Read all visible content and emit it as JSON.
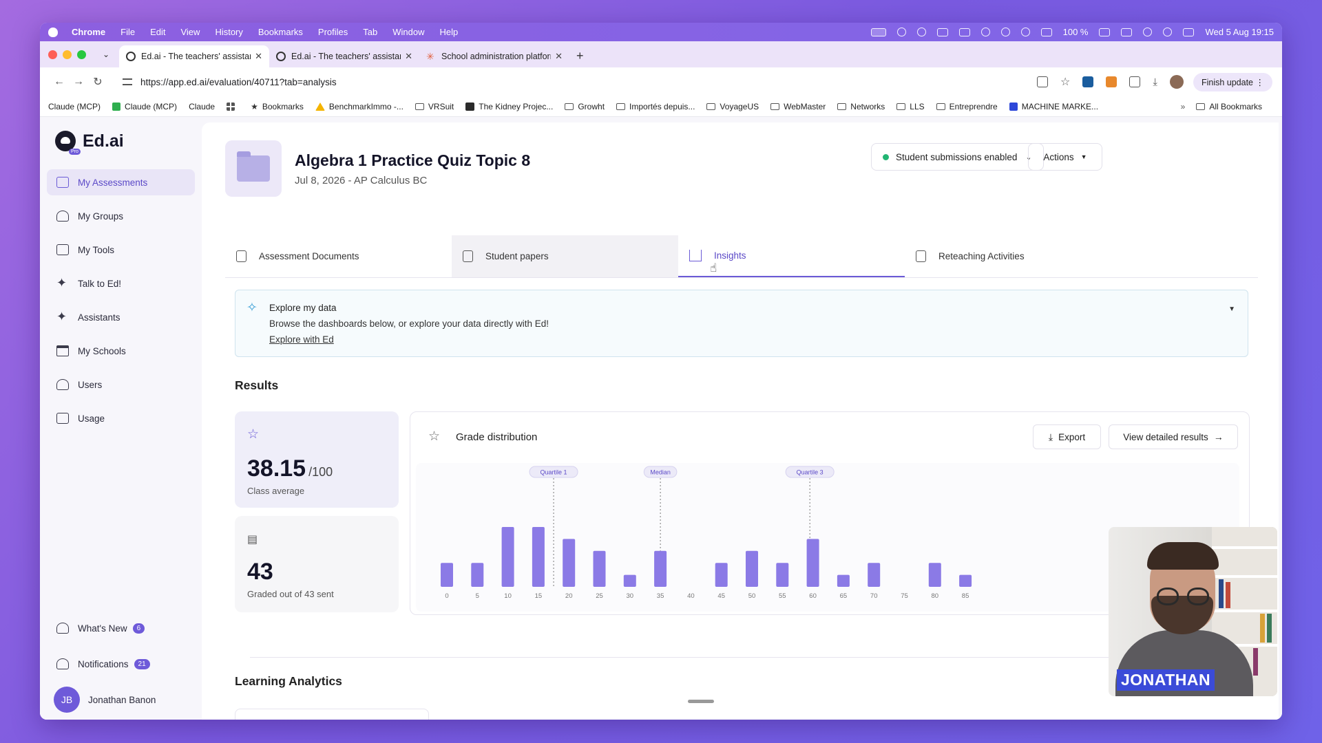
{
  "menubar": {
    "app": "Chrome",
    "items": [
      "File",
      "Edit",
      "View",
      "History",
      "Bookmarks",
      "Profiles",
      "Tab",
      "Window",
      "Help"
    ],
    "battery": "100 %",
    "datetime": "Wed 5 Aug  19:15"
  },
  "tabs": [
    {
      "title": "Ed.ai - The teachers' assistan"
    },
    {
      "title": "Ed.ai - The teachers' assistan"
    },
    {
      "title": "School administration platform"
    }
  ],
  "address": {
    "url": "https://app.ed.ai/evaluation/40711?tab=analysis",
    "finish_update": "Finish update"
  },
  "bookmarks": [
    {
      "label": "Claude (MCP)",
      "icon": "none"
    },
    {
      "label": "Claude (MCP)",
      "icon": "check"
    },
    {
      "label": "Claude",
      "icon": "none"
    },
    {
      "label": "",
      "icon": "grid"
    },
    {
      "label": "Bookmarks",
      "icon": "star"
    },
    {
      "label": "BenchmarkImmo -...",
      "icon": "drive"
    },
    {
      "label": "VRSuit",
      "icon": "folder"
    },
    {
      "label": "The Kidney Projec...",
      "icon": "square"
    },
    {
      "label": "Growht",
      "icon": "folder"
    },
    {
      "label": "Importés depuis...",
      "icon": "folder"
    },
    {
      "label": "VoyageUS",
      "icon": "folder"
    },
    {
      "label": "WebMaster",
      "icon": "folder"
    },
    {
      "label": "Networks",
      "icon": "folder"
    },
    {
      "label": "LLS",
      "icon": "folder"
    },
    {
      "label": "Entreprendre",
      "icon": "folder"
    },
    {
      "label": "MACHINE MARKE...",
      "icon": "blue"
    }
  ],
  "bookmarks_all": "All Bookmarks",
  "sidebar": {
    "brand": "Ed.ai",
    "pro": "Pro",
    "items": [
      {
        "label": "My Assessments"
      },
      {
        "label": "My Groups"
      },
      {
        "label": "My Tools"
      },
      {
        "label": "Talk to Ed!"
      },
      {
        "label": "Assistants"
      },
      {
        "label": "My Schools"
      },
      {
        "label": "Users"
      },
      {
        "label": "Usage"
      }
    ],
    "whats_new": "What's New",
    "whats_new_count": "6",
    "notifications": "Notifications",
    "notifications_count": "21",
    "user_initials": "JB",
    "user_name": "Jonathan Banon"
  },
  "header": {
    "title": "Algebra 1 Practice Quiz Topic 8",
    "subtitle": "Jul 8, 2026 - AP Calculus BC",
    "submissions": "Student submissions enabled",
    "actions": "Actions"
  },
  "page_tabs": [
    {
      "label": "Assessment Documents"
    },
    {
      "label": "Student papers"
    },
    {
      "label": "Insights"
    },
    {
      "label": "Reteaching Activities"
    }
  ],
  "explore": {
    "title": "Explore my data",
    "description": "Browse the dashboards below, or explore your data directly with Ed!",
    "link": "Explore with Ed"
  },
  "results": {
    "heading": "Results",
    "average": "38.15",
    "average_max": "/100",
    "average_label": "Class average",
    "graded": "43",
    "graded_label": "Graded out of 43 sent"
  },
  "grade_distribution": {
    "title": "Grade distribution",
    "export": "Export",
    "view": "View detailed results"
  },
  "learning_analytics": "Learning Analytics",
  "webcam_name": "JONATHAN",
  "colors": {
    "accent": "#6e5ad9",
    "bar": "#8b7ae6",
    "status": "#22b573"
  },
  "chart_data": {
    "type": "bar",
    "title": "Grade distribution",
    "categories": [
      0,
      5,
      10,
      15,
      20,
      25,
      30,
      35,
      40,
      45,
      50,
      55,
      60,
      65,
      70,
      75,
      80,
      85
    ],
    "values": [
      2,
      2,
      5,
      5,
      4,
      3,
      1,
      3,
      0,
      2,
      3,
      2,
      4,
      1,
      2,
      0,
      2,
      1
    ],
    "annotations": [
      {
        "label": "Quartile 1",
        "x": 17.5
      },
      {
        "label": "Median",
        "x": 35
      },
      {
        "label": "Quartile 3",
        "x": 59.5
      }
    ],
    "ylim": [
      0,
      6
    ],
    "grid": false
  }
}
